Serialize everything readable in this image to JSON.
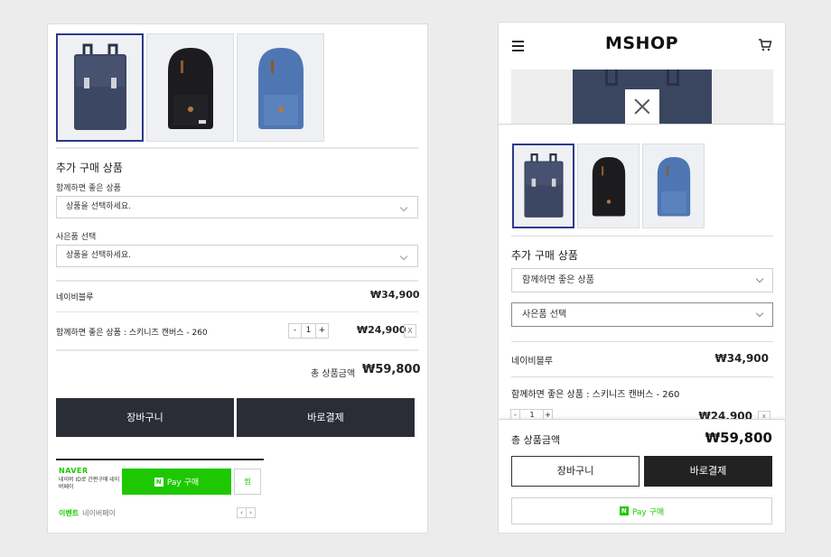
{
  "desktop": {
    "section_title": "추가 구매 상품",
    "recommend_label": "함께하면 좋은 상품",
    "recommend_placeholder": "상품을 선택하세요.",
    "gift_label": "사은품 선택",
    "gift_placeholder": "상품을 선택하세요.",
    "item1_name": "네이비블루",
    "item1_price": "₩34,900",
    "item2_name": "함께하면 좋은 상품 : 스키니즈 캔버스 - 260",
    "item2_qty": "1",
    "item2_price": "₩24,900",
    "minus": "-",
    "plus": "+",
    "remove": "X",
    "total_label": "총 상품금액",
    "total_value": "₩59,800",
    "cart_button": "장바구니",
    "buy_button": "바로결제",
    "naver": {
      "logo": "NAVER",
      "sub": "네이버 ID로 간편구매 네이버페이",
      "pay_badge": "N",
      "pay_label": "Pay 구매",
      "zzim": "찜",
      "event": "이벤트",
      "naverpay": "네이버페이",
      "prev": "‹",
      "next": "›"
    }
  },
  "mobile": {
    "logo": "MSHOP",
    "section_title": "추가 구매 상품",
    "recommend_select": "함께하면 좋은 상품",
    "gift_select": "사은품 선택",
    "item1_name": "네이비블루",
    "item1_price": "₩34,900",
    "item2_name": "함께하면 좋은 상품 : 스키니즈 캔버스 - 260",
    "item2_qty": "1",
    "item2_price": "₩24,900",
    "minus": "-",
    "plus": "+",
    "remove": "x",
    "total_label": "총 상품금액",
    "total_value": "₩59,800",
    "cart_button": "장바구니",
    "buy_button": "바로결제",
    "pay_badge": "N",
    "pay_label": "Pay 구매"
  },
  "colors": {
    "selected_border": "#2b3a8c",
    "dark_button": "#2a2d36",
    "naver_green": "#1ec800"
  },
  "icons": [
    "menu-icon",
    "cart-icon",
    "close-icon",
    "chevron-down-icon",
    "backpack-navy",
    "backpack-black",
    "backpack-blue"
  ]
}
